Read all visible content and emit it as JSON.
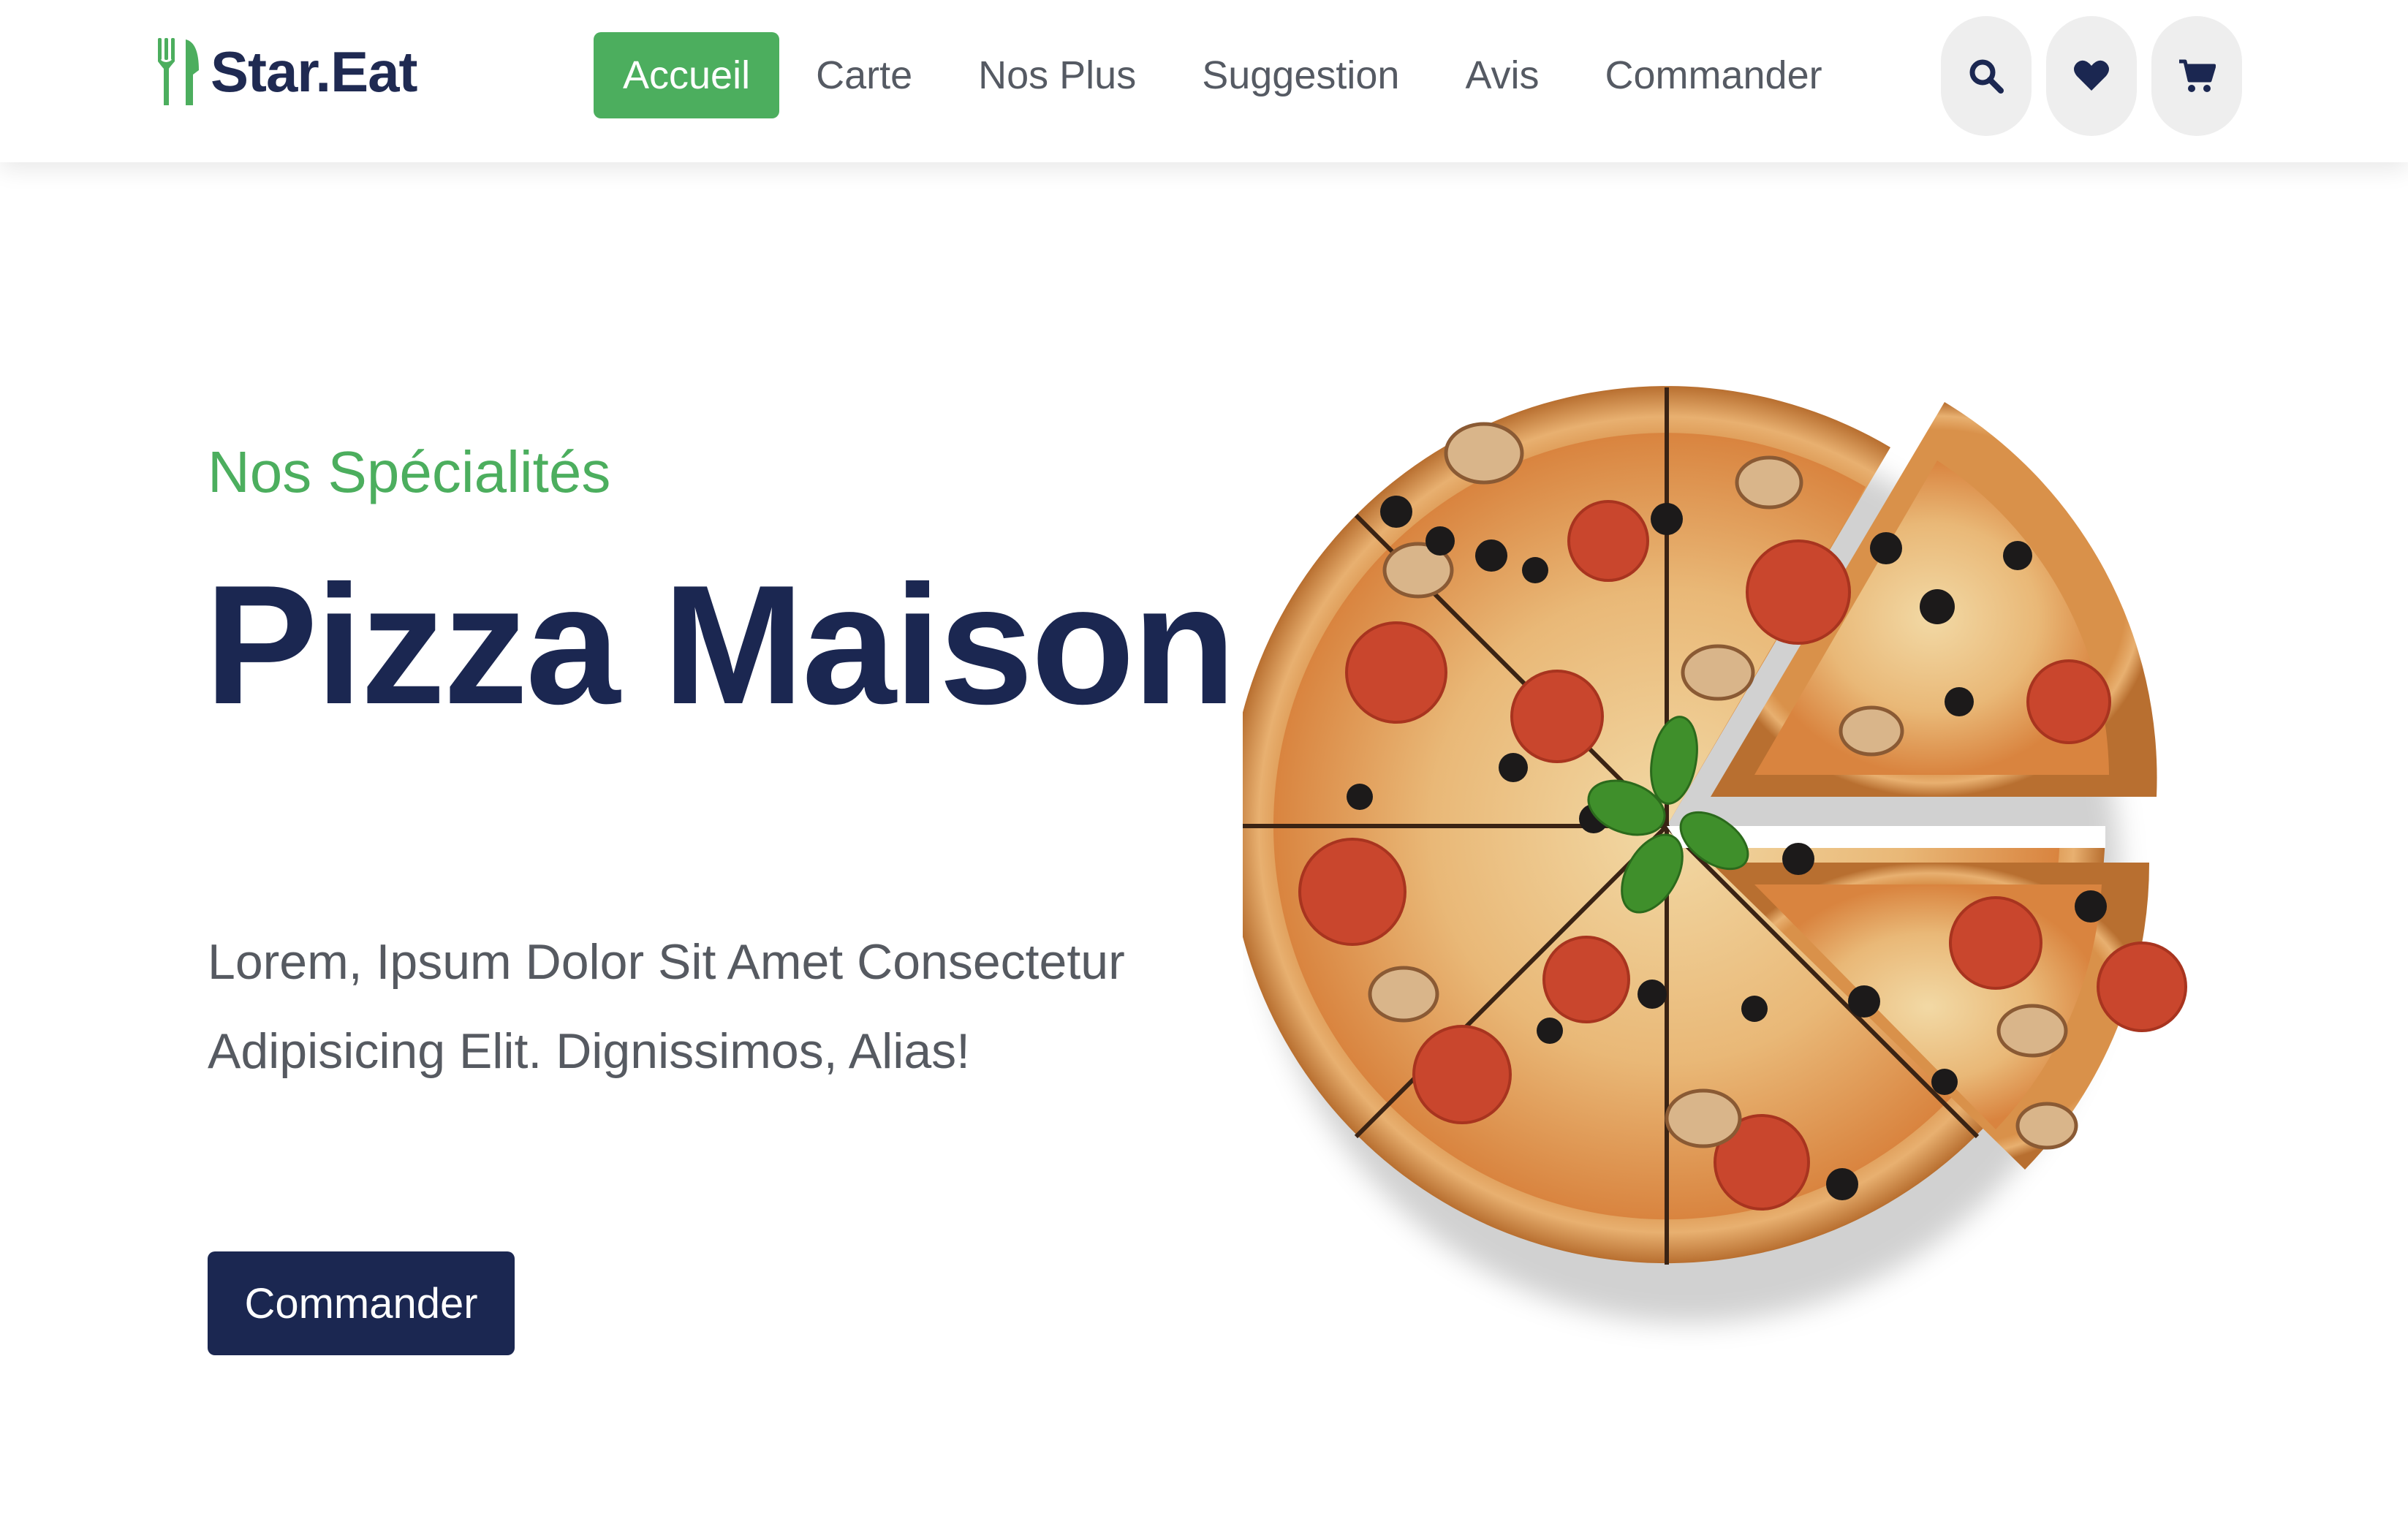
{
  "header": {
    "brand": "Star.Eat",
    "logo_icon": "utensils-icon",
    "nav": [
      {
        "label": "Accueil",
        "active": true
      },
      {
        "label": "Carte",
        "active": false
      },
      {
        "label": "Nos Plus",
        "active": false
      },
      {
        "label": "Suggestion",
        "active": false
      },
      {
        "label": "Avis",
        "active": false
      },
      {
        "label": "Commander",
        "active": false
      }
    ],
    "icons": [
      "search-icon",
      "heart-icon",
      "cart-icon"
    ]
  },
  "hero": {
    "subtitle": "Nos Spécialités",
    "title": "Pizza Maison",
    "description": "Lorem, Ipsum Dolor Sit Amet Consectetur Adipisicing Elit. Dignissimos, Alias!",
    "button_label": "Commander",
    "image": "pizza-image"
  },
  "colors": {
    "brand_green": "#4cae5e",
    "brand_navy": "#1b2751",
    "nav_text": "#555a63",
    "icon_button_bg": "#eeeeee"
  }
}
